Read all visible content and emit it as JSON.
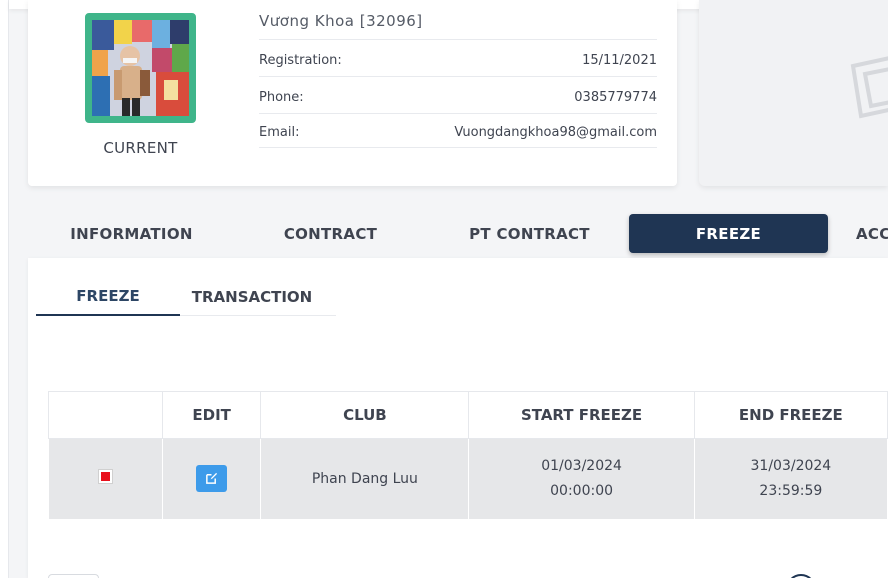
{
  "profile": {
    "name": "Vương Khoa [32096]",
    "avatar_caption": "CURRENT",
    "fields": [
      {
        "label": "Registration:",
        "value": "15/11/2021"
      },
      {
        "label": "Phone:",
        "value": "0385779774"
      },
      {
        "label": "Email:",
        "value": "Vuongdangkhoa98@gmail.com"
      }
    ]
  },
  "tabs": [
    {
      "label": "INFORMATION",
      "active": false
    },
    {
      "label": "CONTRACT",
      "active": false
    },
    {
      "label": "PT CONTRACT",
      "active": false
    },
    {
      "label": "FREEZE",
      "active": true
    },
    {
      "label": "ACC",
      "active": false
    }
  ],
  "subtabs": [
    {
      "label": "FREEZE",
      "active": true
    },
    {
      "label": "TRANSACTION",
      "active": false
    }
  ],
  "table": {
    "columns": [
      "",
      "EDIT",
      "CLUB",
      "START FREEZE",
      "END FREEZE"
    ],
    "rows": [
      {
        "status_color": "#e8101c",
        "edit_icon": "edit-icon",
        "club": "Phan Dang Luu",
        "start_date": "01/03/2024",
        "start_time": "00:00:00",
        "end_date": "31/03/2024",
        "end_time": "23:59:59"
      }
    ]
  },
  "colors": {
    "accent": "#1f3553",
    "avatar_border": "#3fb58a",
    "edit_button": "#3d9bea",
    "status_red": "#e8101c"
  }
}
